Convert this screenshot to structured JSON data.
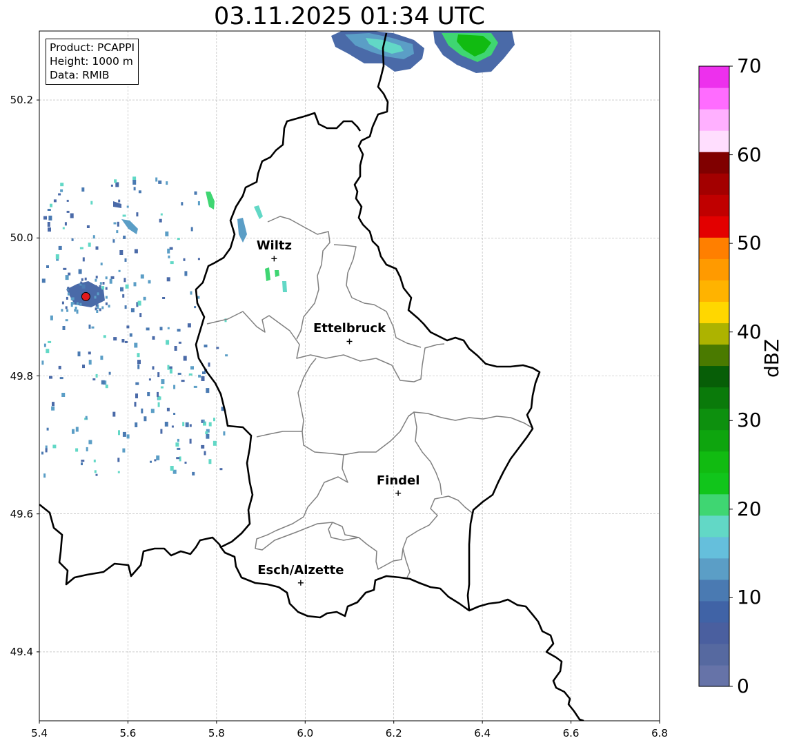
{
  "title": "03.11.2025 01:34 UTC",
  "info_box": {
    "product": "Product: PCAPPI",
    "height": "Height: 1000 m",
    "data": "Data: RMIB"
  },
  "axes": {
    "x_ticks": [
      "5.4",
      "5.6",
      "5.8",
      "6.0",
      "6.2",
      "6.4",
      "6.6",
      "6.8"
    ],
    "y_ticks": [
      "50.2",
      "50.0",
      "49.8",
      "49.6",
      "49.4"
    ],
    "xlim": [
      5.4,
      6.8
    ],
    "ylim": [
      49.3,
      50.3
    ],
    "grid": true
  },
  "cities": [
    {
      "name": "Wiltz",
      "lon": 5.93,
      "lat": 49.97
    },
    {
      "name": "Ettelbruck",
      "lon": 6.1,
      "lat": 49.85
    },
    {
      "name": "Findel",
      "lon": 6.21,
      "lat": 49.63
    },
    {
      "name": "Esch/Alzette",
      "lon": 5.99,
      "lat": 49.5
    }
  ],
  "radar_site": {
    "lon": 5.505,
    "lat": 49.915,
    "color": "#e31a1c"
  },
  "colorbar": {
    "label": "dBZ",
    "ticks": [
      "0",
      "10",
      "20",
      "30",
      "40",
      "50",
      "60",
      "70"
    ],
    "range": [
      0,
      70
    ],
    "colors": [
      "#6673a8",
      "#5669a0",
      "#4a5f9f",
      "#4063a6",
      "#4a7ab2",
      "#5b9ec6",
      "#65bfdc",
      "#62d8c6",
      "#3fd672",
      "#11c51b",
      "#11bb11",
      "#0ea50e",
      "#0d900e",
      "#0a7a0a",
      "#075e07",
      "#4a7a00",
      "#adb300",
      "#ffd700",
      "#ffb300",
      "#ff9a00",
      "#ff7f00",
      "#e30000",
      "#c00000",
      "#a30000",
      "#800000",
      "#ffdefe",
      "#ffb0ff",
      "#ff6cff",
      "#ed30ed"
    ]
  }
}
